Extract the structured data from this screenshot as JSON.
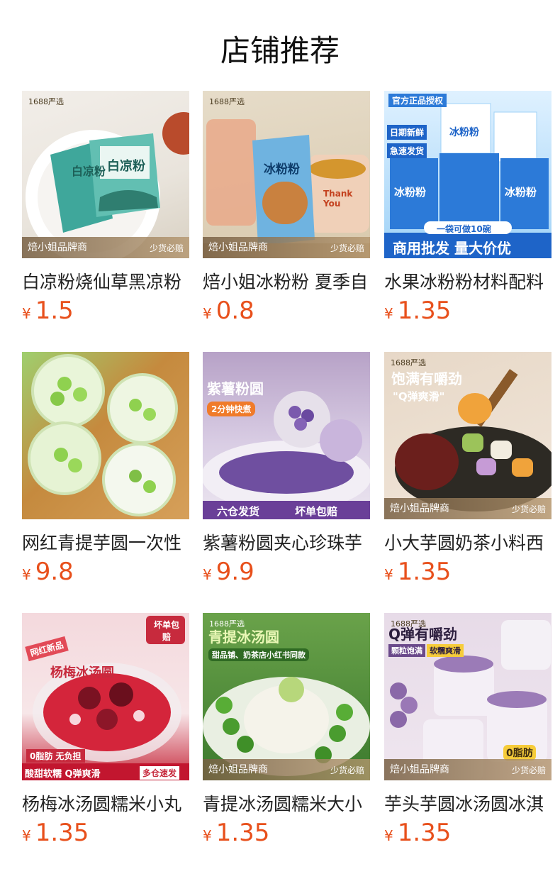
{
  "page_title": "店铺推荐",
  "currency": "¥",
  "products": [
    {
      "name": "白凉粉烧仙草黑凉粉",
      "price": "1.5",
      "tag": "1688严选",
      "brand": "焙小姐品牌商",
      "badge": "少货必赔",
      "texts": [
        "白凉粉",
        "白凉粉"
      ]
    },
    {
      "name": "焙小姐冰粉粉 夏季自",
      "price": "0.8",
      "tag": "1688严选",
      "brand": "焙小姐品牌商",
      "badge": "少货必赔",
      "texts": [
        "冰粉粉",
        "Thank You"
      ]
    },
    {
      "name": "水果冰粉粉材料配料",
      "price": "1.35",
      "tag": "官方正品授权",
      "texts": [
        "日期新鲜",
        "急速发货",
        "冰粉粉",
        "冰粉粉",
        "冰粉粉",
        "一袋可做10碗",
        "商用批发 量大价优"
      ]
    },
    {
      "name": "网红青提芋圆一次性",
      "price": "9.8",
      "texts": []
    },
    {
      "name": "紫薯粉圆夹心珍珠芋",
      "price": "9.9",
      "texts": [
        "紫薯粉圆",
        "2分钟快煮",
        "六仓发货",
        "坏单包赔"
      ]
    },
    {
      "name": "小大芋圆奶茶小料西",
      "price": "1.35",
      "tag": "1688严选",
      "brand": "焙小姐品牌商",
      "badge": "少货必赔",
      "texts": [
        "饱满有嚼劲",
        "\"Q弹爽滑\""
      ]
    },
    {
      "name": "杨梅冰汤圆糯米小丸",
      "price": "1.35",
      "texts": [
        "网红新品",
        "杨梅冰汤圆",
        "坏单包赔",
        "0脂肪 无负担",
        "酸甜软糯 Q弹爽滑",
        "多仓速发"
      ]
    },
    {
      "name": "青提冰汤圆糯米大小",
      "price": "1.35",
      "tag": "1688严选",
      "brand": "焙小姐品牌商",
      "badge": "少货必赔",
      "texts": [
        "青提冰汤圆",
        "甜品铺、奶茶店小红书同款"
      ]
    },
    {
      "name": "芋头芋圆冰汤圆冰淇",
      "price": "1.35",
      "tag": "1688严选",
      "brand": "焙小姐品牌商",
      "badge": "少货必赔",
      "texts": [
        "Q弹有嚼劲",
        "颗粒饱满",
        "软糯爽滑",
        "0脂肪"
      ]
    }
  ]
}
